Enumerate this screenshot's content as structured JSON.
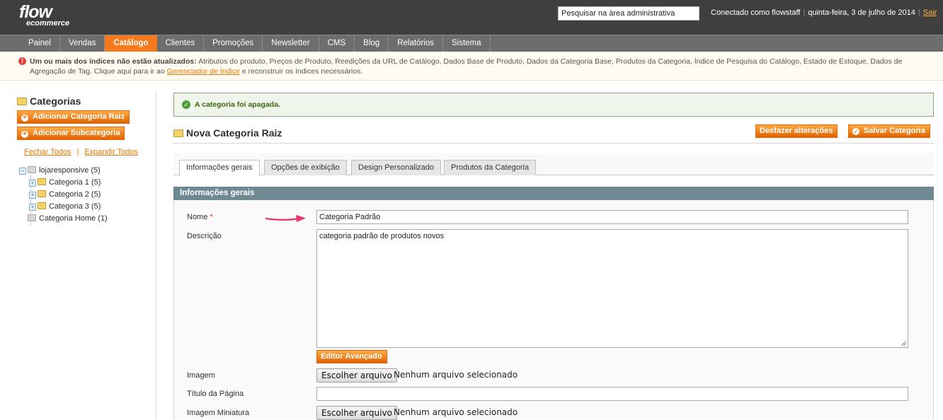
{
  "header": {
    "logo_line1": "flow",
    "logo_line2": "ecommerce",
    "search_placeholder": "Pesquisar na área administrativa",
    "connected_as": "Conectado como flowstaff",
    "date": "quinta-feira, 3 de julho de 2014",
    "logout": "Sair"
  },
  "nav": {
    "items": [
      {
        "label": "Painel"
      },
      {
        "label": "Vendas"
      },
      {
        "label": "Catálogo"
      },
      {
        "label": "Clientes"
      },
      {
        "label": "Promoções"
      },
      {
        "label": "Newsletter"
      },
      {
        "label": "CMS"
      },
      {
        "label": "Blog"
      },
      {
        "label": "Relatórios"
      },
      {
        "label": "Sistema"
      }
    ],
    "active": "Catálogo"
  },
  "notice": {
    "bold": "Um ou mais dos índices não estão atualizados:",
    "text1": " Atributos do produto, Preços de Produto, Reedições da URL de Catálogo, Dados Base de Produto, Dados da Categoria Base, Produtos da Categoria, Índice de Pesquisa do Catálogo, Estado de Estoque, Dados de Agregação de Tag. Clique aqui para ir ao ",
    "link": "Gerenciador de Índice",
    "text2": " e reconstruir os índices necessários."
  },
  "sidebar": {
    "title": "Categorias",
    "add_root": "Adicionar Categoria Raiz",
    "add_sub": "Adicionar Subcategoria",
    "collapse_all": "Fechar Todos",
    "expand_all": "Expandir Todos",
    "tree": [
      {
        "label": "lojaresponsive (5)"
      },
      {
        "label": "Categoria 1 (5)"
      },
      {
        "label": "Categoria 2 (5)"
      },
      {
        "label": "Categoria 3 (5)"
      },
      {
        "label": "Categoria Home (1)"
      }
    ]
  },
  "main": {
    "success_message": "A categoria foi apagada.",
    "page_title": "Nova Categoria Raiz",
    "reset_button": "Desfazer alterações",
    "save_button": "Salvar Categoria",
    "tabs": [
      {
        "label": "Informações gerais"
      },
      {
        "label": "Opções de exibição"
      },
      {
        "label": "Design Personalizado"
      },
      {
        "label": "Produtos da Categoria"
      }
    ],
    "active_tab": "Informações gerais",
    "section_title": "Informações gerais",
    "form": {
      "name_label": "Nome",
      "required_mark": "*",
      "name_value": "Categoria Padrão",
      "description_label": "Descrição",
      "description_value": "categoria padrão de produtos novos",
      "wysiwyg_button": "Editor Avançado",
      "image_label": "Imagem",
      "choose_file": "Escolher arquivo",
      "no_file": "Nenhum arquivo selecionado",
      "page_title_label": "Título da Página",
      "page_title_value": "",
      "thumbnail_label": "Imagem Miniatura",
      "thumb_choose_file": "Escolher arquivo",
      "thumb_no_file": "Nenhum arquivo selecionado"
    }
  },
  "colors": {
    "header_bg": "#3f3f3f",
    "nav_bg": "#6d6d6d",
    "accent_orange": "#f57a1d",
    "section_head": "#6f8992",
    "success_green": "#3d6611",
    "annotation_arrow": "#e8336b"
  }
}
